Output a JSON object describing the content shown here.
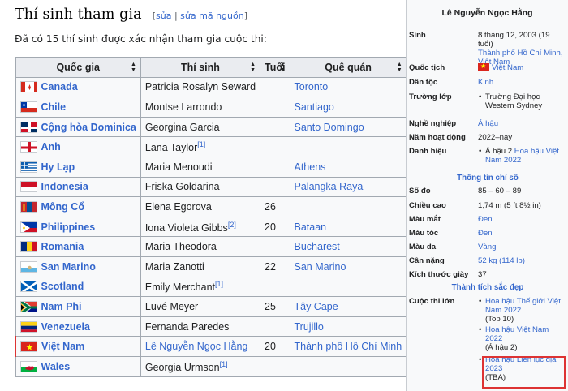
{
  "section": {
    "title": "Thí sinh tham gia",
    "edit_open": "[",
    "edit_label": "sửa",
    "edit_sep": " | ",
    "edit_source_label": "sửa mã nguồn",
    "edit_close": "]",
    "intro": "Đã có 15 thí sinh được xác nhận tham gia cuộc thi:"
  },
  "table": {
    "headers": [
      "Quốc gia",
      "Thí sinh",
      "Tuổi",
      "Quê quán"
    ],
    "rows": [
      {
        "country": "Canada",
        "contestant": "Patricia Rosalyn Seward",
        "ref": "",
        "age": "",
        "hometown": "Toronto",
        "flag": "canada-flag"
      },
      {
        "country": "Chile",
        "contestant": "Montse Larrondo",
        "ref": "",
        "age": "",
        "hometown": "Santiago",
        "flag": "chile-flag"
      },
      {
        "country": "Cộng hòa Dominica",
        "contestant": "Georgina Garcia",
        "ref": "",
        "age": "",
        "hometown": "Santo Domingo",
        "flag": "dominican-flag"
      },
      {
        "country": "Anh",
        "contestant": "Lana Taylor",
        "ref": "[1]",
        "age": "",
        "hometown": "",
        "flag": "england-flag"
      },
      {
        "country": "Hy Lạp",
        "contestant": "Maria Menoudi",
        "ref": "",
        "age": "",
        "hometown": "Athens",
        "flag": "greece-flag"
      },
      {
        "country": "Indonesia",
        "contestant": "Friska Goldarina",
        "ref": "",
        "age": "",
        "hometown": "Palangka Raya",
        "flag": "indonesia-flag"
      },
      {
        "country": "Mông Cổ",
        "contestant": "Elena Egorova",
        "ref": "",
        "age": "26",
        "hometown": "",
        "flag": "mongolia-flag"
      },
      {
        "country": "Philippines",
        "contestant": "Iona Violeta Gibbs",
        "ref": "[2]",
        "age": "20",
        "hometown": "Bataan",
        "flag": "philippines-flag"
      },
      {
        "country": "Romania",
        "contestant": "Maria Theodora",
        "ref": "",
        "age": "",
        "hometown": "Bucharest",
        "flag": "romania-flag"
      },
      {
        "country": "San Marino",
        "contestant": "Maria Zanotti",
        "ref": "",
        "age": "22",
        "hometown": "San Marino",
        "flag": "sanmarino-flag"
      },
      {
        "country": "Scotland",
        "contestant": "Emily Merchant",
        "ref": "[1]",
        "age": "",
        "hometown": "",
        "flag": "scotland-flag"
      },
      {
        "country": "Nam Phi",
        "contestant": "Luvé Meyer",
        "ref": "",
        "age": "25",
        "hometown": "Tây Cape",
        "flag": "southafrica-flag"
      },
      {
        "country": "Venezuela",
        "contestant": "Fernanda Paredes",
        "ref": "",
        "age": "",
        "hometown": "Trujillo",
        "flag": "venezuela-flag"
      },
      {
        "country": "Việt Nam",
        "contestant": "Lê Nguyễn Ngọc Hằng",
        "ref": "",
        "age": "20",
        "hometown": "Thành phố Hồ Chí Minh",
        "flag": "vietnam-flag",
        "contestant_link": true,
        "highlight": true
      },
      {
        "country": "Wales",
        "contestant": "Georgia Urmson",
        "ref": "[1]",
        "age": "",
        "hometown": "",
        "flag": "wales-flag"
      }
    ]
  },
  "infobox": {
    "title": "Lê Nguyễn Ngọc Hằng",
    "birth_label": "Sinh",
    "birth_date": "8 tháng 12, 2003 (19 tuổi)",
    "birth_place": "Thành phố Hồ Chí Minh, Việt Nam",
    "nationality_label": "Quốc tịch",
    "nationality": "Việt Nam",
    "ethnicity_label": "Dân tộc",
    "ethnicity": "Kinh",
    "school_label": "Trường lớp",
    "school": "Trường Đại học Western Sydney",
    "occupation_label": "Nghề nghiệp",
    "occupation": "Á hậu",
    "active_label": "Năm hoạt động",
    "active": "2022–nay",
    "title_label": "Danh hiệu",
    "title_prefix": "Á hậu 2 ",
    "title_link": "Hoa hậu Việt Nam 2022",
    "measurements_head": "Thông tin chỉ số",
    "bust_label": "Số đo",
    "bust": "85 – 60 – 89",
    "height_label": "Chiều cao",
    "height": "1,74 m (5 ft 8½ in)",
    "eye_label": "Màu mắt",
    "eye": "Đen",
    "hair_label": "Màu tóc",
    "hair": "Đen",
    "skin_label": "Màu da",
    "skin": "Vàng",
    "weight_label": "Cân nặng",
    "weight_value": "52 kg (114 lb)",
    "shoe_label": "Kích thước giày",
    "shoe": "37",
    "pageant_head": "Thành tích sắc đẹp",
    "contests_label": "Cuộc thi lớn",
    "contest1": "Hoa hậu Thế giới Việt Nam 2022",
    "contest1_result": "(Top 10)",
    "contest2": "Hoa hậu Việt Nam 2022",
    "contest2_result": "(Á hậu 2)",
    "contest3": "Hoa hậu Liên lục địa 2023",
    "contest3_result": "(TBA)"
  }
}
